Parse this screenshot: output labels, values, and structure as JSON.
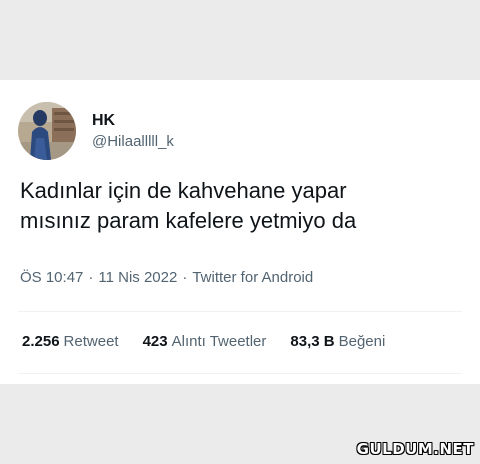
{
  "tweet": {
    "author": {
      "display_name": "HK",
      "handle": "@Hilaalllll_k",
      "avatar_icon": "profile-photo"
    },
    "text": "Kadınlar için de kahvehane yapar\nmısınız param kafelere yetmiyo da",
    "meta": {
      "time": "ÖS 10:47",
      "date": "11 Nis 2022",
      "source": "Twitter for Android",
      "separator": "·"
    },
    "stats": {
      "retweets": {
        "value": "2.256",
        "label": "Retweet"
      },
      "quotes": {
        "value": "423",
        "label": "Alıntı Tweetler"
      },
      "likes": {
        "value": "83,3 B",
        "label": "Beğeni"
      }
    }
  },
  "watermark": "GULDUM.NET",
  "colors": {
    "page_background": "#ebebeb",
    "card_background": "#ffffff",
    "primary_text": "#0f1419",
    "secondary_text": "#536471",
    "divider": "#eff3f4"
  }
}
